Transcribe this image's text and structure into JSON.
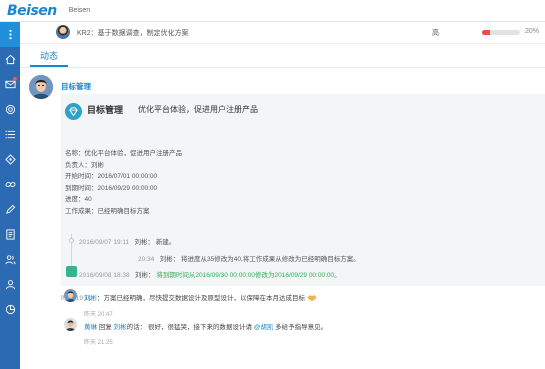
{
  "app": {
    "logo": "Beisen",
    "brand": "Beisen"
  },
  "sidebar": {
    "icons": [
      "menu-icon",
      "home-icon",
      "message-icon",
      "target-icon",
      "list-icon",
      "diamond-icon",
      "link-icon",
      "edit-icon",
      "report-icon",
      "people-icon",
      "person-icon",
      "chart-icon"
    ]
  },
  "kr": {
    "text": "KR2：基于数据调查，制定优化方案",
    "status": "高",
    "progress": 0.2,
    "pct": "20%"
  },
  "tabs": {
    "active": "动态"
  },
  "post": {
    "title": "目标管理",
    "card": {
      "label": "目标管理",
      "title": "优化平台体验，促进用户注册产品",
      "details": [
        "名称：优化平台体验，促进用户注册产品",
        "负责人：刘彬",
        "开始时间：2016/07/01 00:00:00",
        "到期时间：2016/09/29 00:00:00",
        "进度：40",
        "工作成果：已经明确目标方案"
      ]
    },
    "timeline": [
      {
        "time": "2016/09/07 19:11",
        "user": "刘彬：",
        "text": "新建。"
      },
      {
        "time": "20:34",
        "user": "刘彬：",
        "text": "将进度从35修改为40,将工作成果从修改为已经明确目标方案。"
      },
      {
        "time": "2016/09/08 18:38",
        "user": "刘彬：",
        "text": "将到期时间从2016/09/30 00:00:00修改为2016/09/29 00:00:00。"
      }
    ],
    "date": "昨天 19:11"
  },
  "comments": [
    {
      "author": "刘彬",
      "text": "：方案已经明确，尽快提交数据设计及原型设计，以保障在本月达成目标",
      "time": "昨天 20:47"
    },
    {
      "author": "黄琳",
      "reply_word": "回复",
      "reply_to": "刘彬",
      "reply_suffix": "的话：",
      "text": "很好，很猛哭，接下来的数据设计请",
      "mention": "@胡凯",
      "text2": "多给予指导意见。",
      "time": "昨天 21:25"
    }
  ]
}
